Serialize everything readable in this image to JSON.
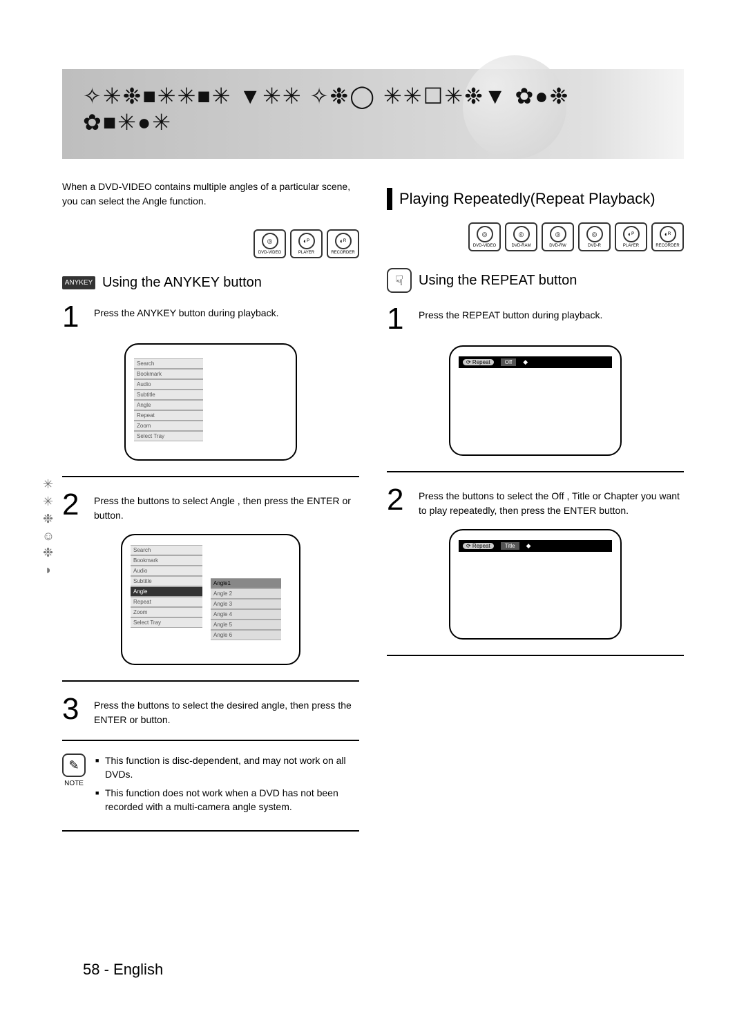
{
  "header": {
    "title_symbols": "✧✳❉■✳✳■✳ ▼✳✳ ✧❉◯ ✳✳☐✳❉▼ ✿●❉ ✿■✳●✳"
  },
  "side_tab": "✳✳❉☺❉◗",
  "left": {
    "intro": "When a DVD-VIDEO contains multiple angles of a particular scene, you can select the Angle function.",
    "icons": [
      "DVD-VIDEO",
      "PLAYER",
      "RECORDER"
    ],
    "anykey_badge": "ANYKEY",
    "subhead": "Using the ANYKEY button",
    "step1_text": "Press the ANYKEY button during playback.",
    "step2_text": "Press the        buttons to select Angle , then press the ENTER or       button.",
    "step3_text": "Press the        buttons to select the desired angle, then press the ENTER or       button.",
    "menu1": [
      "Search",
      "Bookmark",
      "Audio",
      "Subtitle",
      "Angle",
      "Repeat",
      "Zoom",
      "Select Tray"
    ],
    "menu2_main": [
      "Search",
      "Bookmark",
      "Audio",
      "Subtitle",
      "Angle",
      "Repeat",
      "Zoom",
      "Select Tray"
    ],
    "menu2_sub": [
      "Angle1",
      "Angle 2",
      "Angle 3",
      "Angle 4",
      "Angle 5",
      "Angle 6"
    ],
    "note": {
      "label": "NOTE",
      "n1": "This function is disc-dependent, and may not work on all DVDs.",
      "n2": "This function does not work when a DVD has not been recorded with a multi-camera angle system."
    }
  },
  "right": {
    "section_title": "Playing Repeatedly(Repeat Playback)",
    "icons": [
      "DVD-VIDEO",
      "DVD-RAM",
      "DVD-RW",
      "DVD-R",
      "PLAYER",
      "RECORDER"
    ],
    "subhead": "Using the REPEAT button",
    "step1_text": "Press the REPEAT button during playback.",
    "osd1": {
      "pill": "⟳ Repeat",
      "sel": "Off",
      "arrows": "◆"
    },
    "step2_text": "Press the        buttons to select the Off , Title or Chapter you want to play repeatedly, then press the ENTER button.",
    "osd2": {
      "pill": "⟳ Repeat",
      "sel": "Title",
      "arrows": "◆"
    }
  },
  "footer": "58 - English"
}
